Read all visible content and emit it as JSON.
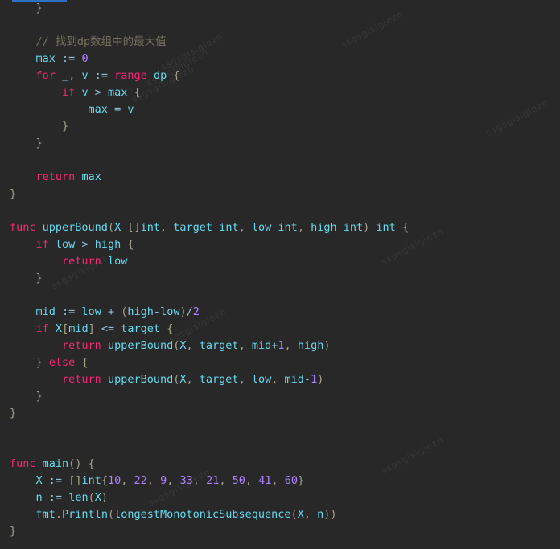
{
  "editor": {
    "language": "Go",
    "theme": "monokai-dark",
    "background_color": "#282828",
    "marker_color": "#2f6fc4",
    "colors": {
      "keyword": "#f92672",
      "identifier": "#66d9ef",
      "number": "#ae81ff",
      "operator": "#8fbfd8",
      "punctuation": "#a6a28c",
      "comment": "#75715e",
      "plain": "#d8d8d2"
    }
  },
  "watermark": {
    "text": "ssgsgisigiezn"
  },
  "code": {
    "lines": [
      {
        "id": 1,
        "indent": 1,
        "tokens": [
          {
            "t": "pun",
            "v": "}"
          }
        ]
      },
      {
        "id": 2,
        "indent": 0,
        "tokens": []
      },
      {
        "id": 3,
        "indent": 1,
        "tokens": [
          {
            "t": "cmt",
            "v": "// 找到dp数组中的最大值"
          }
        ]
      },
      {
        "id": 4,
        "indent": 1,
        "tokens": [
          {
            "t": "fn",
            "v": "max"
          },
          {
            "t": "pl",
            "v": " "
          },
          {
            "t": "op",
            "v": ":="
          },
          {
            "t": "pl",
            "v": " "
          },
          {
            "t": "num",
            "v": "0"
          }
        ]
      },
      {
        "id": 5,
        "indent": 1,
        "tokens": [
          {
            "t": "kw",
            "v": "for"
          },
          {
            "t": "pl",
            "v": " "
          },
          {
            "t": "op",
            "v": "_"
          },
          {
            "t": "pun",
            "v": ","
          },
          {
            "t": "pl",
            "v": " "
          },
          {
            "t": "fn",
            "v": "v"
          },
          {
            "t": "pl",
            "v": " "
          },
          {
            "t": "op",
            "v": ":="
          },
          {
            "t": "pl",
            "v": " "
          },
          {
            "t": "kw",
            "v": "range"
          },
          {
            "t": "pl",
            "v": " "
          },
          {
            "t": "fn",
            "v": "dp"
          },
          {
            "t": "pl",
            "v": " "
          },
          {
            "t": "pun",
            "v": "{"
          }
        ]
      },
      {
        "id": 6,
        "indent": 2,
        "tokens": [
          {
            "t": "kw",
            "v": "if"
          },
          {
            "t": "pl",
            "v": " "
          },
          {
            "t": "fn",
            "v": "v"
          },
          {
            "t": "pl",
            "v": " "
          },
          {
            "t": "op",
            "v": ">"
          },
          {
            "t": "pl",
            "v": " "
          },
          {
            "t": "fn",
            "v": "max"
          },
          {
            "t": "pl",
            "v": " "
          },
          {
            "t": "pun",
            "v": "{"
          }
        ]
      },
      {
        "id": 7,
        "indent": 3,
        "tokens": [
          {
            "t": "fn",
            "v": "max"
          },
          {
            "t": "pl",
            "v": " "
          },
          {
            "t": "op",
            "v": "="
          },
          {
            "t": "pl",
            "v": " "
          },
          {
            "t": "fn",
            "v": "v"
          }
        ]
      },
      {
        "id": 8,
        "indent": 2,
        "tokens": [
          {
            "t": "pun",
            "v": "}"
          }
        ]
      },
      {
        "id": 9,
        "indent": 1,
        "tokens": [
          {
            "t": "pun",
            "v": "}"
          }
        ]
      },
      {
        "id": 10,
        "indent": 0,
        "tokens": []
      },
      {
        "id": 11,
        "indent": 1,
        "tokens": [
          {
            "t": "kw",
            "v": "return"
          },
          {
            "t": "pl",
            "v": " "
          },
          {
            "t": "fn",
            "v": "max"
          }
        ]
      },
      {
        "id": 12,
        "indent": 0,
        "tokens": [
          {
            "t": "pun",
            "v": "}"
          }
        ]
      },
      {
        "id": 13,
        "indent": 0,
        "tokens": []
      },
      {
        "id": 14,
        "indent": 0,
        "tokens": [
          {
            "t": "kw",
            "v": "func"
          },
          {
            "t": "pl",
            "v": " "
          },
          {
            "t": "fn",
            "v": "upperBound"
          },
          {
            "t": "pun",
            "v": "("
          },
          {
            "t": "fn",
            "v": "X"
          },
          {
            "t": "pl",
            "v": " "
          },
          {
            "t": "pun",
            "v": "[]"
          },
          {
            "t": "fn",
            "v": "int"
          },
          {
            "t": "pun",
            "v": ","
          },
          {
            "t": "pl",
            "v": " "
          },
          {
            "t": "fn",
            "v": "target"
          },
          {
            "t": "pl",
            "v": " "
          },
          {
            "t": "fn",
            "v": "int"
          },
          {
            "t": "pun",
            "v": ","
          },
          {
            "t": "pl",
            "v": " "
          },
          {
            "t": "fn",
            "v": "low"
          },
          {
            "t": "pl",
            "v": " "
          },
          {
            "t": "fn",
            "v": "int"
          },
          {
            "t": "pun",
            "v": ","
          },
          {
            "t": "pl",
            "v": " "
          },
          {
            "t": "fn",
            "v": "high"
          },
          {
            "t": "pl",
            "v": " "
          },
          {
            "t": "fn",
            "v": "int"
          },
          {
            "t": "pun",
            "v": ")"
          },
          {
            "t": "pl",
            "v": " "
          },
          {
            "t": "fn",
            "v": "int"
          },
          {
            "t": "pl",
            "v": " "
          },
          {
            "t": "pun",
            "v": "{"
          }
        ]
      },
      {
        "id": 15,
        "indent": 1,
        "tokens": [
          {
            "t": "kw",
            "v": "if"
          },
          {
            "t": "pl",
            "v": " "
          },
          {
            "t": "fn",
            "v": "low"
          },
          {
            "t": "pl",
            "v": " "
          },
          {
            "t": "op",
            "v": ">"
          },
          {
            "t": "pl",
            "v": " "
          },
          {
            "t": "fn",
            "v": "high"
          },
          {
            "t": "pl",
            "v": " "
          },
          {
            "t": "pun",
            "v": "{"
          }
        ]
      },
      {
        "id": 16,
        "indent": 2,
        "tokens": [
          {
            "t": "kw",
            "v": "return"
          },
          {
            "t": "pl",
            "v": " "
          },
          {
            "t": "fn",
            "v": "low"
          }
        ]
      },
      {
        "id": 17,
        "indent": 1,
        "tokens": [
          {
            "t": "pun",
            "v": "}"
          }
        ]
      },
      {
        "id": 18,
        "indent": 0,
        "tokens": []
      },
      {
        "id": 19,
        "indent": 1,
        "tokens": [
          {
            "t": "fn",
            "v": "mid"
          },
          {
            "t": "pl",
            "v": " "
          },
          {
            "t": "op",
            "v": ":="
          },
          {
            "t": "pl",
            "v": " "
          },
          {
            "t": "fn",
            "v": "low"
          },
          {
            "t": "pl",
            "v": " "
          },
          {
            "t": "op",
            "v": "+"
          },
          {
            "t": "pl",
            "v": " "
          },
          {
            "t": "pun",
            "v": "("
          },
          {
            "t": "fn",
            "v": "high"
          },
          {
            "t": "op",
            "v": "-"
          },
          {
            "t": "fn",
            "v": "low"
          },
          {
            "t": "pun",
            "v": ")"
          },
          {
            "t": "op",
            "v": "/"
          },
          {
            "t": "num",
            "v": "2"
          }
        ]
      },
      {
        "id": 20,
        "indent": 1,
        "tokens": [
          {
            "t": "kw",
            "v": "if"
          },
          {
            "t": "pl",
            "v": " "
          },
          {
            "t": "fn",
            "v": "X"
          },
          {
            "t": "pun",
            "v": "["
          },
          {
            "t": "fn",
            "v": "mid"
          },
          {
            "t": "pun",
            "v": "]"
          },
          {
            "t": "pl",
            "v": " "
          },
          {
            "t": "op",
            "v": "<="
          },
          {
            "t": "pl",
            "v": " "
          },
          {
            "t": "fn",
            "v": "target"
          },
          {
            "t": "pl",
            "v": " "
          },
          {
            "t": "pun",
            "v": "{"
          }
        ]
      },
      {
        "id": 21,
        "indent": 2,
        "tokens": [
          {
            "t": "kw",
            "v": "return"
          },
          {
            "t": "pl",
            "v": " "
          },
          {
            "t": "fn",
            "v": "upperBound"
          },
          {
            "t": "pun",
            "v": "("
          },
          {
            "t": "fn",
            "v": "X"
          },
          {
            "t": "pun",
            "v": ","
          },
          {
            "t": "pl",
            "v": " "
          },
          {
            "t": "fn",
            "v": "target"
          },
          {
            "t": "pun",
            "v": ","
          },
          {
            "t": "pl",
            "v": " "
          },
          {
            "t": "fn",
            "v": "mid"
          },
          {
            "t": "op",
            "v": "+"
          },
          {
            "t": "num",
            "v": "1"
          },
          {
            "t": "pun",
            "v": ","
          },
          {
            "t": "pl",
            "v": " "
          },
          {
            "t": "fn",
            "v": "high"
          },
          {
            "t": "pun",
            "v": ")"
          }
        ]
      },
      {
        "id": 22,
        "indent": 1,
        "tokens": [
          {
            "t": "pun",
            "v": "}"
          },
          {
            "t": "pl",
            "v": " "
          },
          {
            "t": "kw",
            "v": "else"
          },
          {
            "t": "pl",
            "v": " "
          },
          {
            "t": "pun",
            "v": "{"
          }
        ]
      },
      {
        "id": 23,
        "indent": 2,
        "tokens": [
          {
            "t": "kw",
            "v": "return"
          },
          {
            "t": "pl",
            "v": " "
          },
          {
            "t": "fn",
            "v": "upperBound"
          },
          {
            "t": "pun",
            "v": "("
          },
          {
            "t": "fn",
            "v": "X"
          },
          {
            "t": "pun",
            "v": ","
          },
          {
            "t": "pl",
            "v": " "
          },
          {
            "t": "fn",
            "v": "target"
          },
          {
            "t": "pun",
            "v": ","
          },
          {
            "t": "pl",
            "v": " "
          },
          {
            "t": "fn",
            "v": "low"
          },
          {
            "t": "pun",
            "v": ","
          },
          {
            "t": "pl",
            "v": " "
          },
          {
            "t": "fn",
            "v": "mid"
          },
          {
            "t": "op",
            "v": "-"
          },
          {
            "t": "num",
            "v": "1"
          },
          {
            "t": "pun",
            "v": ")"
          }
        ]
      },
      {
        "id": 24,
        "indent": 1,
        "tokens": [
          {
            "t": "pun",
            "v": "}"
          }
        ]
      },
      {
        "id": 25,
        "indent": 0,
        "tokens": [
          {
            "t": "pun",
            "v": "}"
          }
        ]
      },
      {
        "id": 26,
        "indent": 0,
        "tokens": []
      },
      {
        "id": 27,
        "indent": 0,
        "tokens": []
      },
      {
        "id": 28,
        "indent": 0,
        "tokens": [
          {
            "t": "kw",
            "v": "func"
          },
          {
            "t": "pl",
            "v": " "
          },
          {
            "t": "fn",
            "v": "main"
          },
          {
            "t": "pun",
            "v": "()"
          },
          {
            "t": "pl",
            "v": " "
          },
          {
            "t": "pun",
            "v": "{"
          }
        ]
      },
      {
        "id": 29,
        "indent": 1,
        "tokens": [
          {
            "t": "fn",
            "v": "X"
          },
          {
            "t": "pl",
            "v": " "
          },
          {
            "t": "op",
            "v": ":="
          },
          {
            "t": "pl",
            "v": " "
          },
          {
            "t": "pun",
            "v": "[]"
          },
          {
            "t": "fn",
            "v": "int"
          },
          {
            "t": "pun",
            "v": "{"
          },
          {
            "t": "num",
            "v": "10"
          },
          {
            "t": "pun",
            "v": ","
          },
          {
            "t": "pl",
            "v": " "
          },
          {
            "t": "num",
            "v": "22"
          },
          {
            "t": "pun",
            "v": ","
          },
          {
            "t": "pl",
            "v": " "
          },
          {
            "t": "num",
            "v": "9"
          },
          {
            "t": "pun",
            "v": ","
          },
          {
            "t": "pl",
            "v": " "
          },
          {
            "t": "num",
            "v": "33"
          },
          {
            "t": "pun",
            "v": ","
          },
          {
            "t": "pl",
            "v": " "
          },
          {
            "t": "num",
            "v": "21"
          },
          {
            "t": "pun",
            "v": ","
          },
          {
            "t": "pl",
            "v": " "
          },
          {
            "t": "num",
            "v": "50"
          },
          {
            "t": "pun",
            "v": ","
          },
          {
            "t": "pl",
            "v": " "
          },
          {
            "t": "num",
            "v": "41"
          },
          {
            "t": "pun",
            "v": ","
          },
          {
            "t": "pl",
            "v": " "
          },
          {
            "t": "num",
            "v": "60"
          },
          {
            "t": "pun",
            "v": "}"
          }
        ]
      },
      {
        "id": 30,
        "indent": 1,
        "tokens": [
          {
            "t": "fn",
            "v": "n"
          },
          {
            "t": "pl",
            "v": " "
          },
          {
            "t": "op",
            "v": ":="
          },
          {
            "t": "pl",
            "v": " "
          },
          {
            "t": "fn",
            "v": "len"
          },
          {
            "t": "pun",
            "v": "("
          },
          {
            "t": "fn",
            "v": "X"
          },
          {
            "t": "pun",
            "v": ")"
          }
        ]
      },
      {
        "id": 31,
        "indent": 1,
        "tokens": [
          {
            "t": "fn",
            "v": "fmt"
          },
          {
            "t": "pun",
            "v": "."
          },
          {
            "t": "fn",
            "v": "Println"
          },
          {
            "t": "pun",
            "v": "("
          },
          {
            "t": "fn",
            "v": "longestMonotonicSubsequence"
          },
          {
            "t": "pun",
            "v": "("
          },
          {
            "t": "fn",
            "v": "X"
          },
          {
            "t": "pun",
            "v": ","
          },
          {
            "t": "pl",
            "v": " "
          },
          {
            "t": "fn",
            "v": "n"
          },
          {
            "t": "pun",
            "v": ")"
          },
          {
            "t": "pun",
            "v": ")"
          }
        ]
      },
      {
        "id": 32,
        "indent": 0,
        "tokens": [
          {
            "t": "pun",
            "v": "}"
          }
        ]
      }
    ]
  }
}
